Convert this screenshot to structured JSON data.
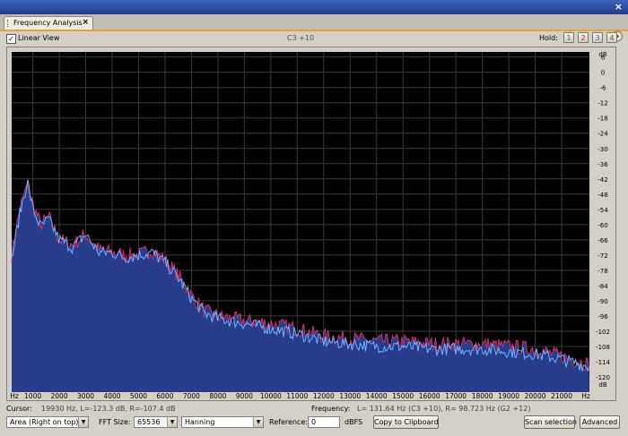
{
  "window": {
    "close_glyph": "×"
  },
  "tab": {
    "label": "Frequency Analysis",
    "close_glyph": "×"
  },
  "toolbar": {
    "linear_view_label": "Linear View",
    "linear_view_checked": true,
    "note_readout": "C3 +10",
    "hold_label": "Hold:",
    "hold_buttons": [
      {
        "label": "1",
        "color": "#2d8a2d"
      },
      {
        "label": "2",
        "color": "#c0205a"
      },
      {
        "label": "3",
        "color": "#3a56c8"
      },
      {
        "label": "4",
        "color": "#6a5a20"
      }
    ]
  },
  "chart_data": {
    "type": "area",
    "xlabel": "Hz",
    "ylabel": "dB",
    "xlim": [
      200,
      22050
    ],
    "ylim": [
      -126,
      8
    ],
    "x_ticks": [
      "Hz",
      "1000",
      "2000",
      "3000",
      "4000",
      "5000",
      "6000",
      "7000",
      "8000",
      "9000",
      "10000",
      "11000",
      "12000",
      "13000",
      "14000",
      "15000",
      "16000",
      "17000",
      "18000",
      "19000",
      "20000",
      "21000",
      "Hz"
    ],
    "y_ticks": [
      "dB",
      "6",
      "0",
      "-6",
      "-12",
      "-18",
      "-24",
      "-30",
      "-36",
      "-42",
      "-48",
      "-54",
      "-60",
      "-66",
      "-72",
      "-78",
      "-84",
      "-90",
      "-96",
      "-102",
      "-108",
      "-114",
      "-120",
      "dB"
    ],
    "grid": true,
    "colors": {
      "background": "#000000",
      "grid": "#3a3a3a",
      "fill": "#283c8c",
      "left_channel": "#d0306a",
      "right_channel": "#6ab4ff"
    },
    "series": [
      {
        "name": "L",
        "x": [
          200,
          500,
          800,
          1000,
          1300,
          1600,
          2000,
          2500,
          3000,
          3500,
          4000,
          4500,
          5000,
          5500,
          6000,
          6500,
          7000,
          7500,
          8000,
          9000,
          10000,
          11000,
          12000,
          13000,
          14000,
          15000,
          16000,
          17000,
          18000,
          19000,
          20000,
          21000,
          22050
        ],
        "y": [
          -72,
          -54,
          -44,
          -52,
          -60,
          -57,
          -66,
          -68,
          -64,
          -70,
          -71,
          -72,
          -72,
          -70,
          -74,
          -80,
          -88,
          -94,
          -96,
          -98,
          -99,
          -101,
          -104,
          -105,
          -106,
          -106,
          -107,
          -107,
          -107,
          -108,
          -109,
          -112,
          -115
        ]
      },
      {
        "name": "R",
        "x": [
          200,
          500,
          800,
          1000,
          1300,
          1600,
          2000,
          2500,
          3000,
          3500,
          4000,
          4500,
          5000,
          5500,
          6000,
          6500,
          7000,
          7500,
          8000,
          9000,
          10000,
          11000,
          12000,
          13000,
          14000,
          15000,
          16000,
          17000,
          18000,
          19000,
          20000,
          21000,
          22050
        ],
        "y": [
          -74,
          -56,
          -43,
          -54,
          -61,
          -58,
          -66,
          -69,
          -64,
          -71,
          -71,
          -73,
          -72,
          -71,
          -75,
          -81,
          -89,
          -95,
          -97,
          -99,
          -101,
          -103,
          -106,
          -107,
          -108,
          -108,
          -109,
          -109,
          -109,
          -110,
          -111,
          -113,
          -116
        ]
      }
    ]
  },
  "status": {
    "cursor_label": "Cursor:",
    "cursor_value": "19930 Hz, L=-123.3 dB, R=-107.4 dB",
    "frequency_label": "Frequency:",
    "frequency_value": "L= 131.64 Hz (C3 +10), R= 98.723 Hz (G2 +12)"
  },
  "controls": {
    "display_mode": "Area (Right on top)",
    "fft_size_label": "FFT Size:",
    "fft_size": "65536",
    "window_func": "Hanning",
    "reference_label": "Reference:",
    "reference_value": "0",
    "reference_unit": "dBFS",
    "copy_button": "Copy to Clipboard",
    "scan_button": "Scan selection",
    "advanced_button": "Advanced",
    "dropdown_glyph": "▼"
  }
}
